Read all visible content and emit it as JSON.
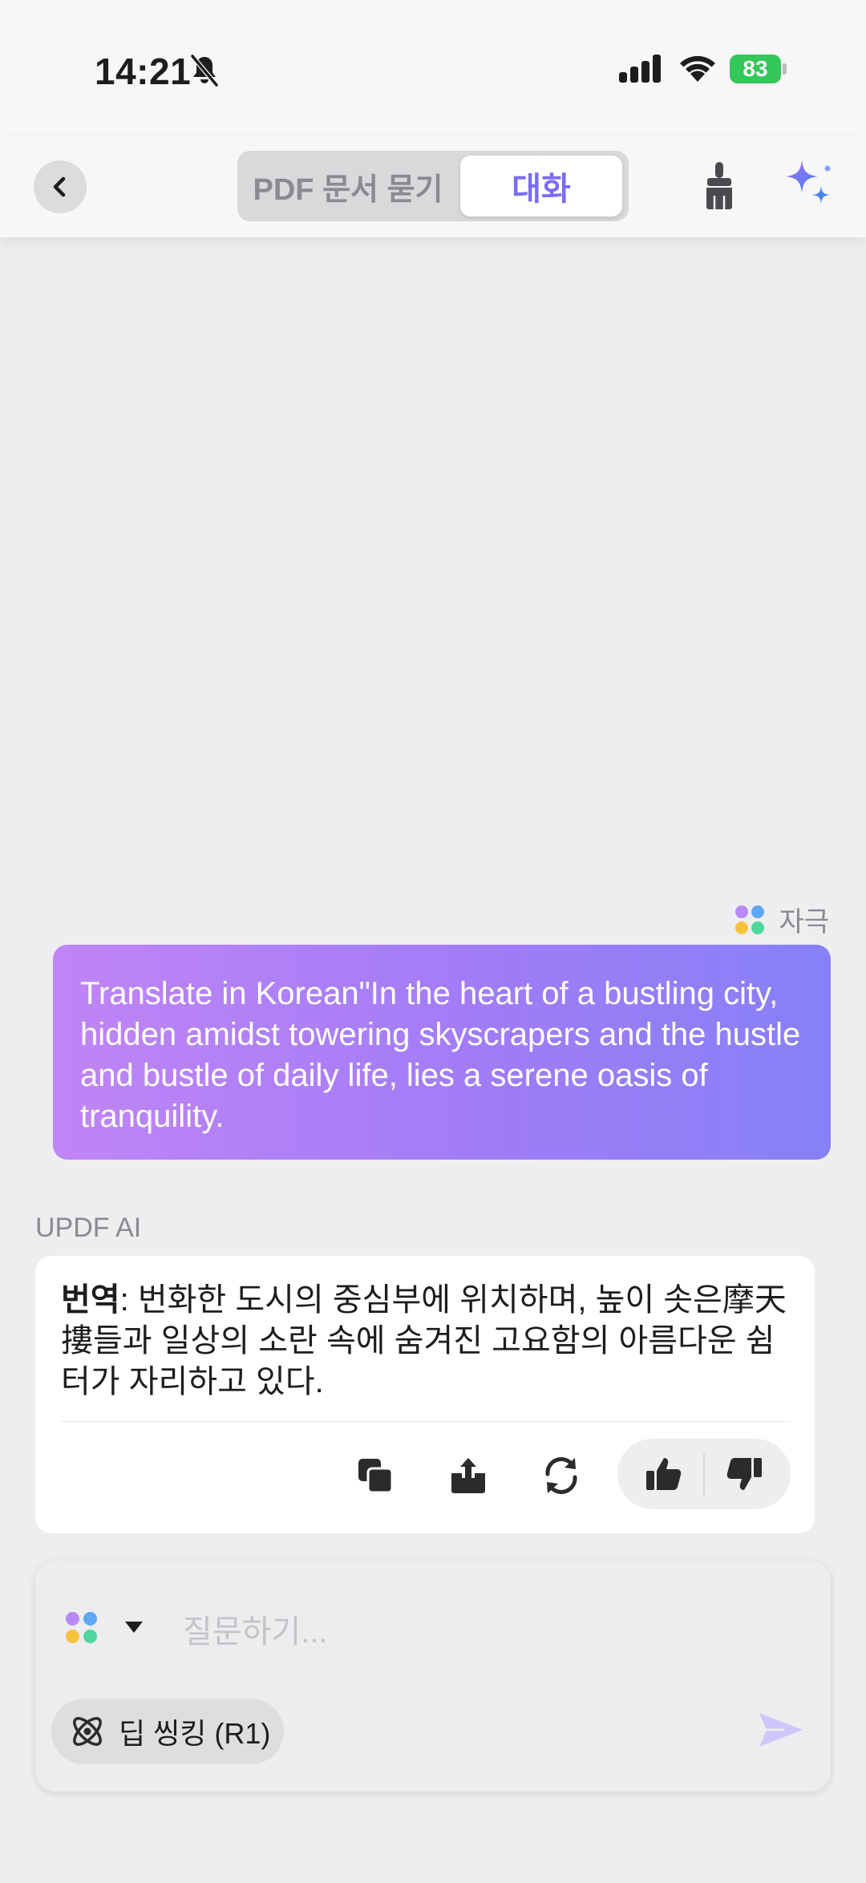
{
  "status_bar": {
    "time": "14:21",
    "battery": "83"
  },
  "header": {
    "tab_pdf": "PDF 문서 묻기",
    "tab_chat": "대화",
    "accent": "#7a6cf5"
  },
  "conversation": {
    "user_sender": "자극",
    "user_message": "Translate in Korean\"In the heart of a bustling city, hidden amidst towering skyscrapers and the hustle and bustle of daily life, lies a serene oasis of tranquility.",
    "ai_label": "UPDF AI",
    "ai_prefix": "번역",
    "ai_message": ": 번화한 도시의 중심부에 위치하며, 높이 솟은摩天摟들과 일상의 소란 속에 숨겨진 고요함의 아름다운 쉼터가 자리하고 있다."
  },
  "input": {
    "placeholder": "질문하기...",
    "deep_thinking_label": "딥 씽킹 (R1)"
  },
  "icons": [
    "bell-slash-icon",
    "signal-icon",
    "wifi-icon",
    "battery-icon",
    "back-chevron-icon",
    "broom-icon",
    "sparkle-icon",
    "copy-icon",
    "share-icon",
    "regenerate-icon",
    "thumbs-up-icon",
    "thumbs-down-icon",
    "model-dots-icon",
    "caret-down-icon",
    "atom-icon",
    "send-icon"
  ]
}
